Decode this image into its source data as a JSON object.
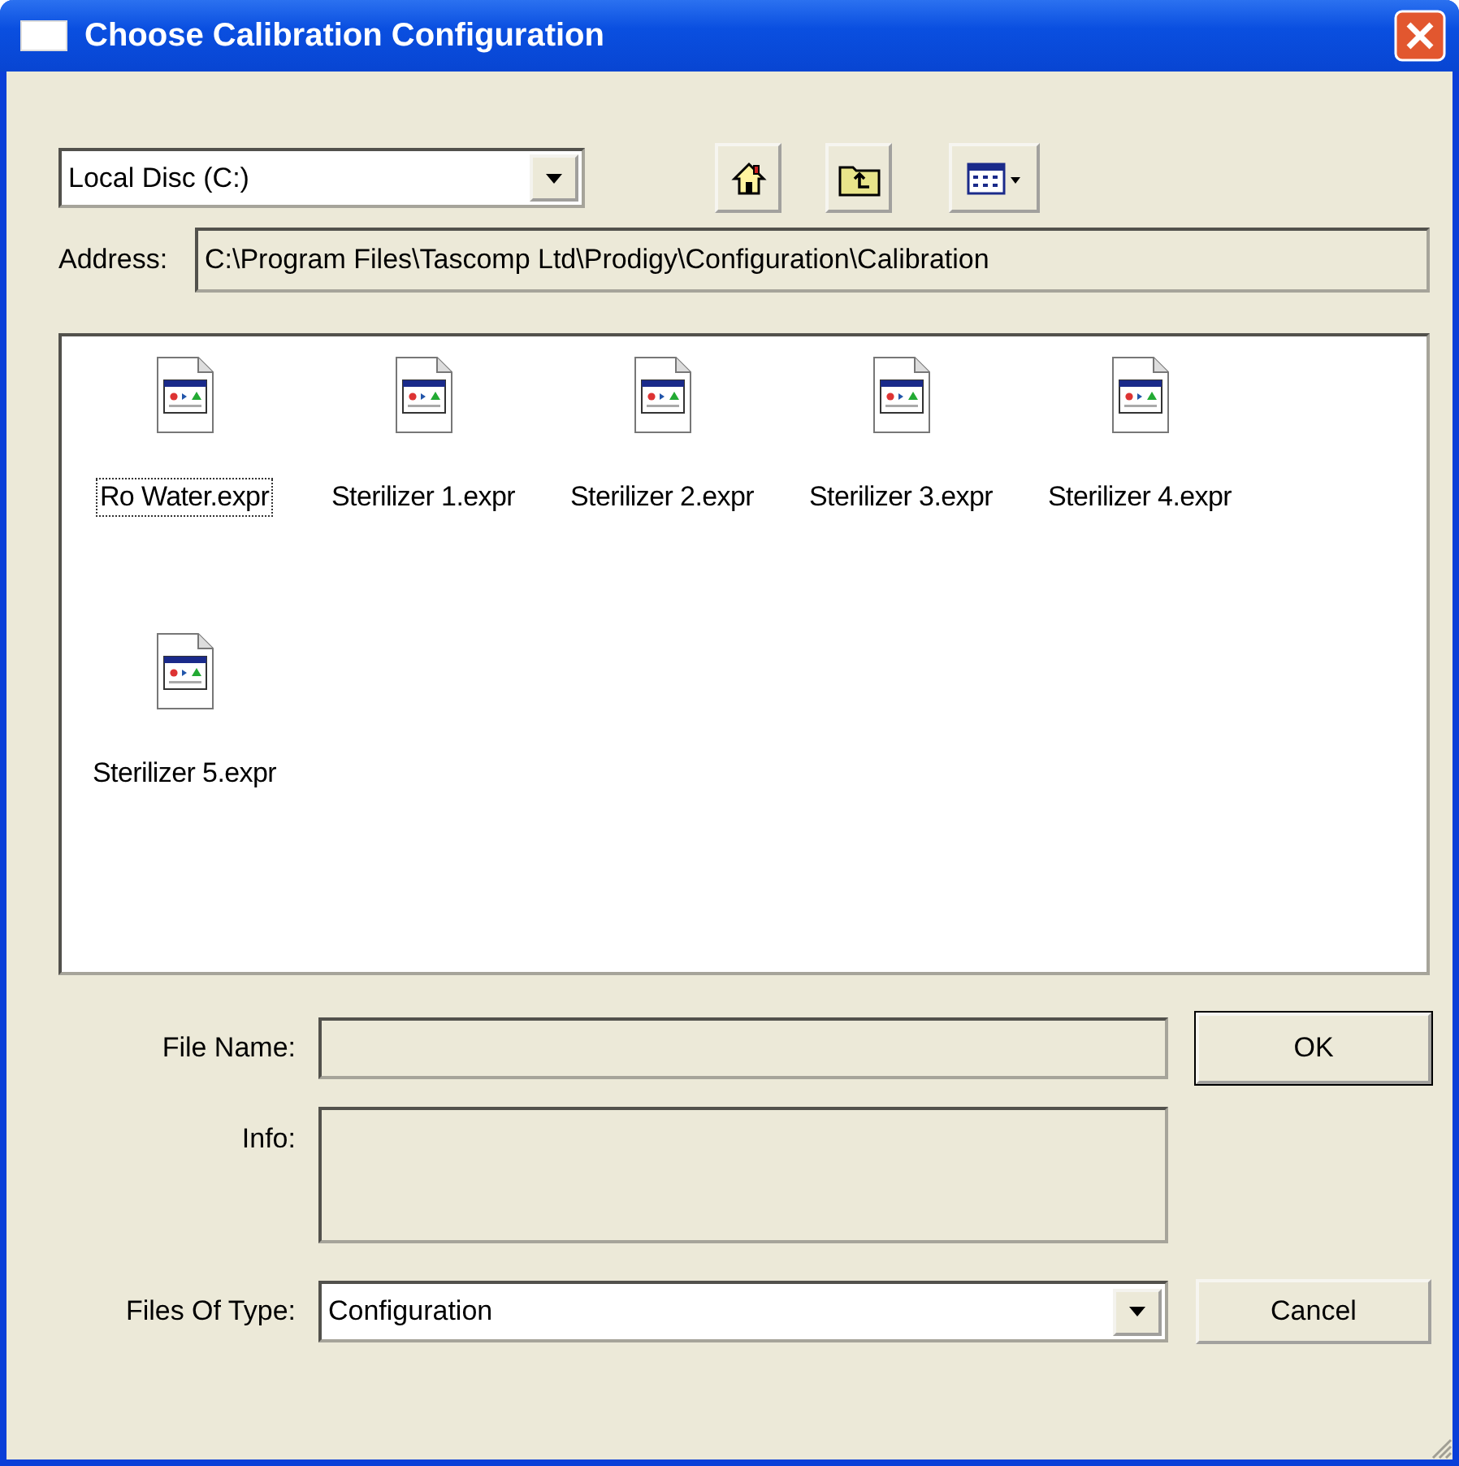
{
  "window": {
    "title": "Choose Calibration Configuration"
  },
  "location": {
    "drive": "Local Disc (C:)",
    "address_label": "Address:",
    "address": "C:\\Program Files\\Tascomp Ltd\\Prodigy\\Configuration\\Calibration"
  },
  "files": [
    {
      "name": "Ro Water.expr",
      "selected": true
    },
    {
      "name": "Sterilizer 1.expr",
      "selected": false
    },
    {
      "name": "Sterilizer 2.expr",
      "selected": false
    },
    {
      "name": "Sterilizer 3.expr",
      "selected": false
    },
    {
      "name": "Sterilizer 4.expr",
      "selected": false
    },
    {
      "name": "Sterilizer 5.expr",
      "selected": false
    }
  ],
  "form": {
    "file_name_label": "File Name:",
    "info_label": "Info:",
    "type_label": "Files Of Type:",
    "type_value": "Configuration"
  },
  "buttons": {
    "ok": "OK",
    "cancel": "Cancel"
  }
}
